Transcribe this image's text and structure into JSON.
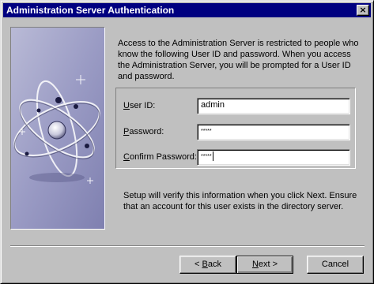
{
  "window": {
    "title": "Administration Server Authentication",
    "close_glyph": "×"
  },
  "intro": "Access to the Administration Server is restricted to people who know the following User ID and password.  When you access the Administration Server, you will be prompted for a User ID and password.",
  "fields": {
    "user_id": {
      "label_ul": "U",
      "label_rest": "ser ID:",
      "value": "admin"
    },
    "password": {
      "label_ul": "P",
      "label_rest": "assword:",
      "value": "*****"
    },
    "confirm_password": {
      "label_ul": "C",
      "label_rest": "onfirm Password:",
      "value": "*****"
    }
  },
  "verify": "Setup will verify this information when you click Next.  Ensure that an account for this user exists in the directory server.",
  "buttons": {
    "back": {
      "prefix": "< ",
      "ul": "B",
      "rest": "ack"
    },
    "next": {
      "ul": "N",
      "rest": "ext >"
    },
    "cancel": {
      "label": "Cancel"
    }
  },
  "icons": {
    "close": "close-icon",
    "art": "atom-orbit-graphic"
  },
  "colors": {
    "face": "#c0c0c0",
    "titlebar": "#000080",
    "art_bg": "#8b8cb8"
  }
}
